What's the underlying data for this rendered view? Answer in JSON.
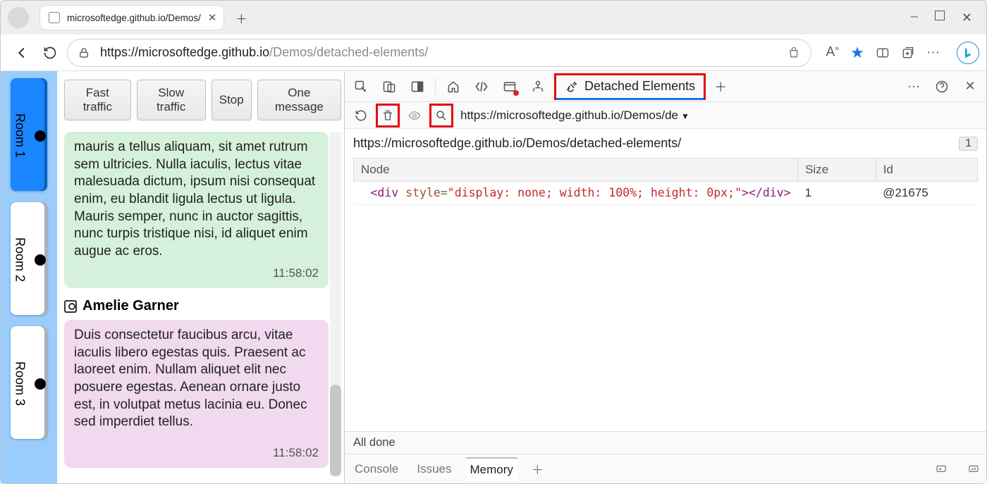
{
  "browser": {
    "tab_title": "microsoftedge.github.io/Demos/",
    "url_host": "https://microsoftedge.github.io",
    "url_path": "/Demos/detached-elements/"
  },
  "page": {
    "rooms": [
      {
        "label": "Room 1",
        "active": true
      },
      {
        "label": "Room 2",
        "active": false
      },
      {
        "label": "Room 3",
        "active": false
      }
    ],
    "traffic_buttons": [
      "Fast traffic",
      "Slow traffic",
      "Stop",
      "One message"
    ],
    "messages": [
      {
        "body": "mauris a tellus aliquam, sit amet rutrum sem ultricies. Nulla iaculis, lectus vitae malesuada dictum, ipsum nisi consequat enim, eu blandit ligula lectus ut ligula. Mauris semper, nunc in auctor sagittis, nunc turpis tristique nisi, id aliquet enim augue ac eros.",
        "time": "11:58:02",
        "color": "green"
      },
      {
        "sender": "Amelie Garner",
        "body": "Duis consectetur faucibus arcu, vitae iaculis libero egestas quis. Praesent ac laoreet enim. Nullam aliquet elit nec posuere egestas. Aenean ornare justo est, in volutpat metus lacinia eu. Donec sed imperdiet tellus.",
        "time": "11:58:02",
        "color": "pink"
      }
    ]
  },
  "devtools": {
    "active_panel": "Detached Elements",
    "frame_url_short": "https://microsoftedge.github.io/Demos/de",
    "frame_url_full": "https://microsoftedge.github.io/Demos/detached-elements/",
    "count": "1",
    "table": {
      "headers": [
        "Node",
        "Size",
        "Id"
      ],
      "row": {
        "tag_open": "<div",
        "attr": "style",
        "val": "\"display: none; width: 100%; height: 0px;\"",
        "tag_mid": ">",
        "tag_close": "</div>",
        "size": "1",
        "id": "@21675"
      }
    },
    "status": "All done",
    "drawer_tabs": [
      "Console",
      "Issues",
      "Memory"
    ]
  }
}
